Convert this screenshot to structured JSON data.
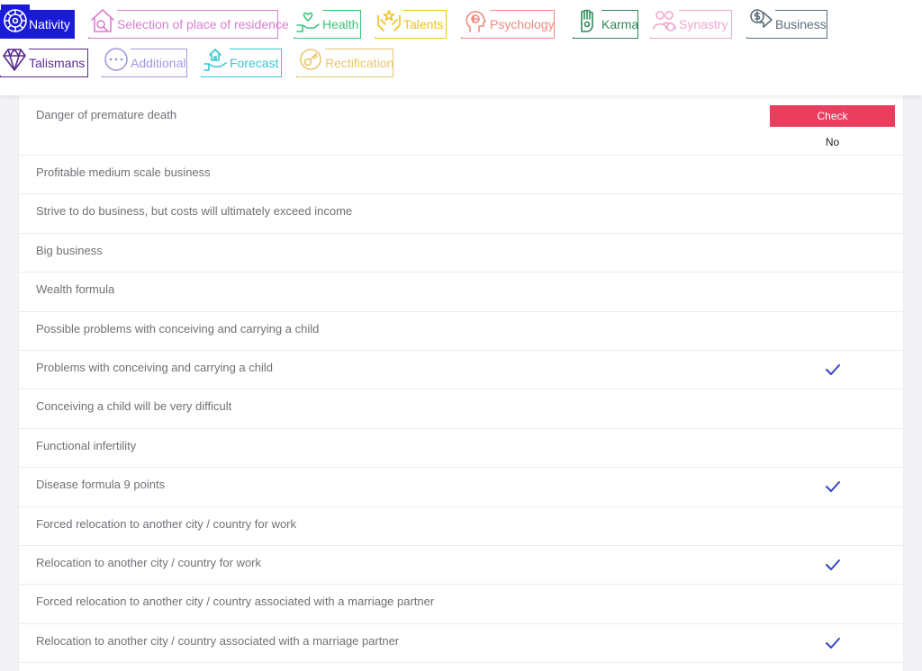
{
  "tabs": [
    {
      "key": "nativity",
      "label": "Nativity",
      "color": "#ffffff",
      "icon": "nativity-wheel-icon",
      "active": true
    },
    {
      "key": "residence",
      "label": "Selection of place of residence",
      "color": "#d97ed0",
      "icon": "house-search-icon"
    },
    {
      "key": "health",
      "label": "Health",
      "color": "#3cc47c",
      "icon": "heart-hand-icon"
    },
    {
      "key": "talents",
      "label": "Talents",
      "color": "#f2c21b",
      "icon": "talents-hands-icon"
    },
    {
      "key": "psychology",
      "label": "Psychology",
      "color": "#f08a80",
      "icon": "brain-head-icon"
    },
    {
      "key": "karma",
      "label": "Karma",
      "color": "#2e8a5b",
      "icon": "karma-hand-icon"
    },
    {
      "key": "synastry",
      "label": "Synastry",
      "color": "#f3a6cf",
      "icon": "couple-icon"
    },
    {
      "key": "business",
      "label": "Business",
      "color": "#5b6f7a",
      "icon": "money-hand-icon"
    },
    {
      "key": "talismans",
      "label": "Talismans",
      "color": "#5a2c91",
      "icon": "diamond-icon"
    },
    {
      "key": "additional",
      "label": "Additional",
      "color": "#9f9be0",
      "icon": "more-dots-icon"
    },
    {
      "key": "forecast",
      "label": "Forecast",
      "color": "#38c6d3",
      "icon": "house-hand-icon"
    },
    {
      "key": "rectification",
      "label": "Rectification",
      "color": "#e8c66e",
      "icon": "target-key-icon"
    }
  ],
  "check_button": "Check",
  "first_result": "No",
  "rows": [
    {
      "label": "Danger of premature death",
      "checked": false
    },
    {
      "label": "Profitable medium scale business",
      "checked": false
    },
    {
      "label": "Strive to do business, but costs will ultimately exceed income",
      "checked": false
    },
    {
      "label": "Big business",
      "checked": false
    },
    {
      "label": "Wealth formula",
      "checked": false
    },
    {
      "label": "Possible problems with conceiving and carrying a child",
      "checked": false
    },
    {
      "label": "Problems with conceiving and carrying a child",
      "checked": true
    },
    {
      "label": "Conceiving a child will be very difficult",
      "checked": false
    },
    {
      "label": "Functional infertility",
      "checked": false
    },
    {
      "label": "Disease formula 9 points",
      "checked": true
    },
    {
      "label": "Forced relocation to another city / country for work",
      "checked": false
    },
    {
      "label": "Relocation to another city / country for work",
      "checked": true
    },
    {
      "label": "Forced relocation to another city / country associated with a marriage partner",
      "checked": false
    },
    {
      "label": "Relocation to another city / country associated with a marriage partner",
      "checked": true
    }
  ],
  "colors": {
    "accent": "#1a1bd6",
    "check": "#ea3e5f",
    "tick": "#2f44c4"
  }
}
